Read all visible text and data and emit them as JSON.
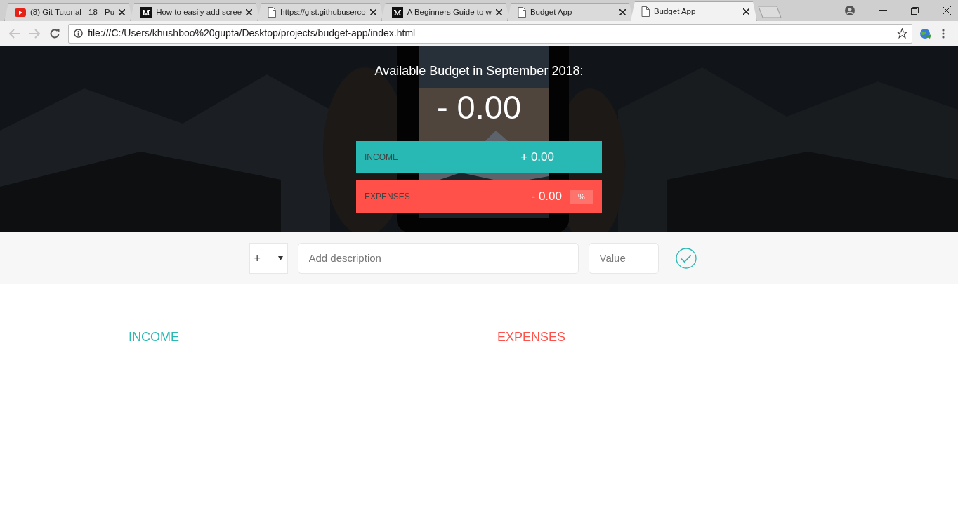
{
  "browser": {
    "tabs": [
      {
        "kind": "video",
        "title": "(8) Git Tutorial - 18 - Pu",
        "selected": false
      },
      {
        "kind": "article",
        "title": "How to easily add scree",
        "selected": false
      },
      {
        "kind": "file",
        "title": "https://gist.githubuserco",
        "selected": false
      },
      {
        "kind": "article",
        "title": "A Beginners Guide to w",
        "selected": false
      },
      {
        "kind": "file",
        "title": "Budget App",
        "selected": false
      },
      {
        "kind": "file",
        "title": "Budget App",
        "selected": true
      }
    ],
    "address": "file:///C:/Users/khushboo%20gupta/Desktop/projects/budget-app/index.html"
  },
  "budget": {
    "title": "Available Budget in September 2018:",
    "amount": "- 0.00",
    "income": {
      "label": "INCOME",
      "value": "+ 0.00"
    },
    "expenses": {
      "label": "EXPENSES",
      "value": "- 0.00",
      "percentage": "%"
    }
  },
  "add_form": {
    "type": "+",
    "description": {
      "placeholder": "Add description"
    },
    "value": {
      "placeholder": "Value"
    }
  },
  "lists": {
    "income_title": "INCOME",
    "expenses_title": "EXPENSES"
  }
}
